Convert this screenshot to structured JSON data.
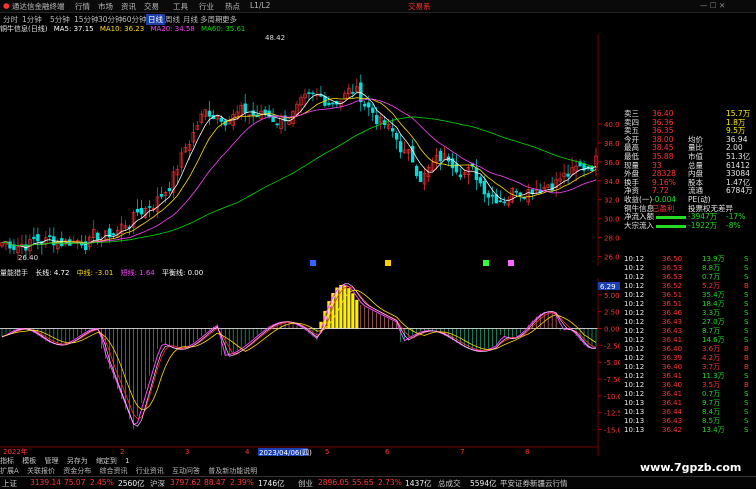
{
  "app": {
    "title": "通达信金融终端",
    "menus": [
      "行情",
      "市场",
      "资讯",
      "交易",
      "工具",
      "行业",
      "热点",
      "L1/L2"
    ],
    "trade_btn": "交易系"
  },
  "timebar": {
    "items": [
      "分时",
      "1分钟",
      "5分钟",
      "15分钟",
      "30分钟",
      "60分钟",
      "日线",
      "周线",
      "月线",
      "多周期",
      "更多"
    ],
    "active": "日线"
  },
  "ma_legend": {
    "name": "铜牛信息(日线)",
    "items": [
      {
        "label": "MA5: 37.15",
        "color": "#ffffff"
      },
      {
        "label": "MA10: 36.23",
        "color": "#ffdd00"
      },
      {
        "label": "MA20: 34.58",
        "color": "#ff44ff"
      },
      {
        "label": "MA60: 35.61",
        "color": "#00dd00"
      }
    ]
  },
  "price_axis": {
    "ticks": [
      "40.00",
      "38.00",
      "36.00",
      "34.00",
      "32.00",
      "30.00",
      "28.00",
      "26.00"
    ],
    "high_label": "48.42",
    "low_label": "26.40"
  },
  "macd_legend": {
    "name": "量能猎手",
    "items": [
      {
        "label": "长线: 4.72",
        "color": "#ffffff"
      },
      {
        "label": "中线: -3.01",
        "color": "#ffdd00"
      },
      {
        "label": "短线: 1.64",
        "color": "#ff44ff"
      },
      {
        "label": "平衡线: 0.00",
        "color": "#ffffff"
      }
    ]
  },
  "macd_axis": {
    "current": "6.29",
    "ticks": [
      "5.00",
      "2.50",
      "0.00",
      "-2.50",
      "-5.00",
      "-7.50",
      "-10.00",
      "-12.50",
      "-15.00"
    ]
  },
  "date_axis": {
    "labels": [
      "2022年",
      "2",
      "3",
      "4",
      "5",
      "6",
      "7",
      "8"
    ],
    "highlight": "2023/04/06(四)"
  },
  "bottom_tabs": [
    "指标",
    "模板",
    "管理",
    "另存为",
    "缩定到",
    "1"
  ],
  "nav2": [
    "扩展A",
    "关联报价",
    "资金分布",
    "综合资讯",
    "行业资讯",
    "互动问答",
    "普及新功能说明"
  ],
  "quote": [
    {
      "l": "卖三",
      "p": "36.40",
      "v": "15.7万"
    },
    {
      "l": "卖四",
      "p": "36.36",
      "v": "1.8万"
    },
    {
      "l": "卖五",
      "p": "36.35",
      "v": "9.5万"
    },
    {
      "l": "今开",
      "p": "38.00",
      "l2": "均价",
      "v": "36.94"
    },
    {
      "l": "最高",
      "p": "38.45",
      "l2": "量比",
      "v": "2.00"
    },
    {
      "l": "最低",
      "p": "35.88",
      "l2": "市值",
      "v": "51.3亿"
    },
    {
      "l": "现量",
      "p": "33",
      "l2": "总量",
      "v": "61412"
    },
    {
      "l": "外盘",
      "p": "28328",
      "l2": "内盘",
      "v": "33084"
    },
    {
      "l": "换手",
      "p": "9.16%",
      "l2": "股本",
      "v": "1.47亿"
    },
    {
      "l": "净资",
      "p": "7.72",
      "l2": "流通",
      "v": "6784万"
    },
    {
      "l": "收益(一)",
      "p": "-0.004",
      "l2": "PE(动)",
      "v": ""
    },
    {
      "l": "铜牛信息",
      "p": "已盈利",
      "l2": "投票权无差异",
      "v": ""
    },
    {
      "l": "净流入额",
      "p": "",
      "l2": "-3947万",
      "v": "-17%"
    },
    {
      "l": "大宗流入",
      "p": "",
      "l2": "-1922万",
      "v": "-8%"
    }
  ],
  "ticks": [
    {
      "t": "10:12",
      "p": "36.50",
      "v": "13.9万",
      "s": "S"
    },
    {
      "t": "10:12",
      "p": "36.53",
      "v": "8.8万",
      "s": "S"
    },
    {
      "t": "10:12",
      "p": "36.53",
      "v": "0.7万",
      "s": "S"
    },
    {
      "t": "10:12",
      "p": "36.52",
      "v": "5.2万",
      "s": "B"
    },
    {
      "t": "10:12",
      "p": "36.51",
      "v": "35.4万",
      "s": "S"
    },
    {
      "t": "10:12",
      "p": "36.51",
      "v": "18.4万",
      "s": "S"
    },
    {
      "t": "10:12",
      "p": "36.46",
      "v": "3.3万",
      "s": "S"
    },
    {
      "t": "10:12",
      "p": "36.43",
      "v": "27.0万",
      "s": "S"
    },
    {
      "t": "10:12",
      "p": "36.43",
      "v": "8.7万",
      "s": "S"
    },
    {
      "t": "10:12",
      "p": "36.41",
      "v": "14.6万",
      "s": "S"
    },
    {
      "t": "10:12",
      "p": "36.40",
      "v": "3.6万",
      "s": "B"
    },
    {
      "t": "10:12",
      "p": "36.39",
      "v": "4.2万",
      "s": "B"
    },
    {
      "t": "10:12",
      "p": "36.40",
      "v": "3.7万",
      "s": "B"
    },
    {
      "t": "10:12",
      "p": "36.41",
      "v": "11.3万",
      "s": "S"
    },
    {
      "t": "10:12",
      "p": "36.40",
      "v": "3.5万",
      "s": "B"
    },
    {
      "t": "10:12",
      "p": "36.41",
      "v": "0.7万",
      "s": "S"
    },
    {
      "t": "10:13",
      "p": "36.41",
      "v": "9.7万",
      "s": "S"
    },
    {
      "t": "10:13",
      "p": "36.44",
      "v": "8.4万",
      "s": "S"
    },
    {
      "t": "10:13",
      "p": "36.43",
      "v": "8.5万",
      "s": "S"
    },
    {
      "t": "10:13",
      "p": "36.42",
      "v": "13.4万",
      "s": "S"
    }
  ],
  "status": [
    {
      "t": "上证",
      "c": "#ccc"
    },
    {
      "t": "3139.14",
      "c": "#ff3333"
    },
    {
      "t": "75.07",
      "c": "#ff3333"
    },
    {
      "t": "2.45%",
      "c": "#ff3333"
    },
    {
      "t": "2560亿",
      "c": "#eee"
    },
    {
      "t": "沪深",
      "c": "#ccc"
    },
    {
      "t": "3797.62",
      "c": "#ff3333"
    },
    {
      "t": "88.47",
      "c": "#ff3333"
    },
    {
      "t": "2.39%",
      "c": "#ff3333"
    },
    {
      "t": "1746亿",
      "c": "#eee"
    },
    {
      "t": "创业",
      "c": "#ccc"
    },
    {
      "t": "2896.05",
      "c": "#ff3333"
    },
    {
      "t": "55.65",
      "c": "#ff3333"
    },
    {
      "t": "2.73%",
      "c": "#ff3333"
    },
    {
      "t": "1437亿",
      "c": "#eee"
    },
    {
      "t": "总成交",
      "c": "#ccc"
    },
    {
      "t": "5594亿",
      "c": "#eee"
    },
    {
      "t": "平安证券新疆云行情",
      "c": "#ccc"
    }
  ],
  "watermark": "www.7gpzb.com"
}
